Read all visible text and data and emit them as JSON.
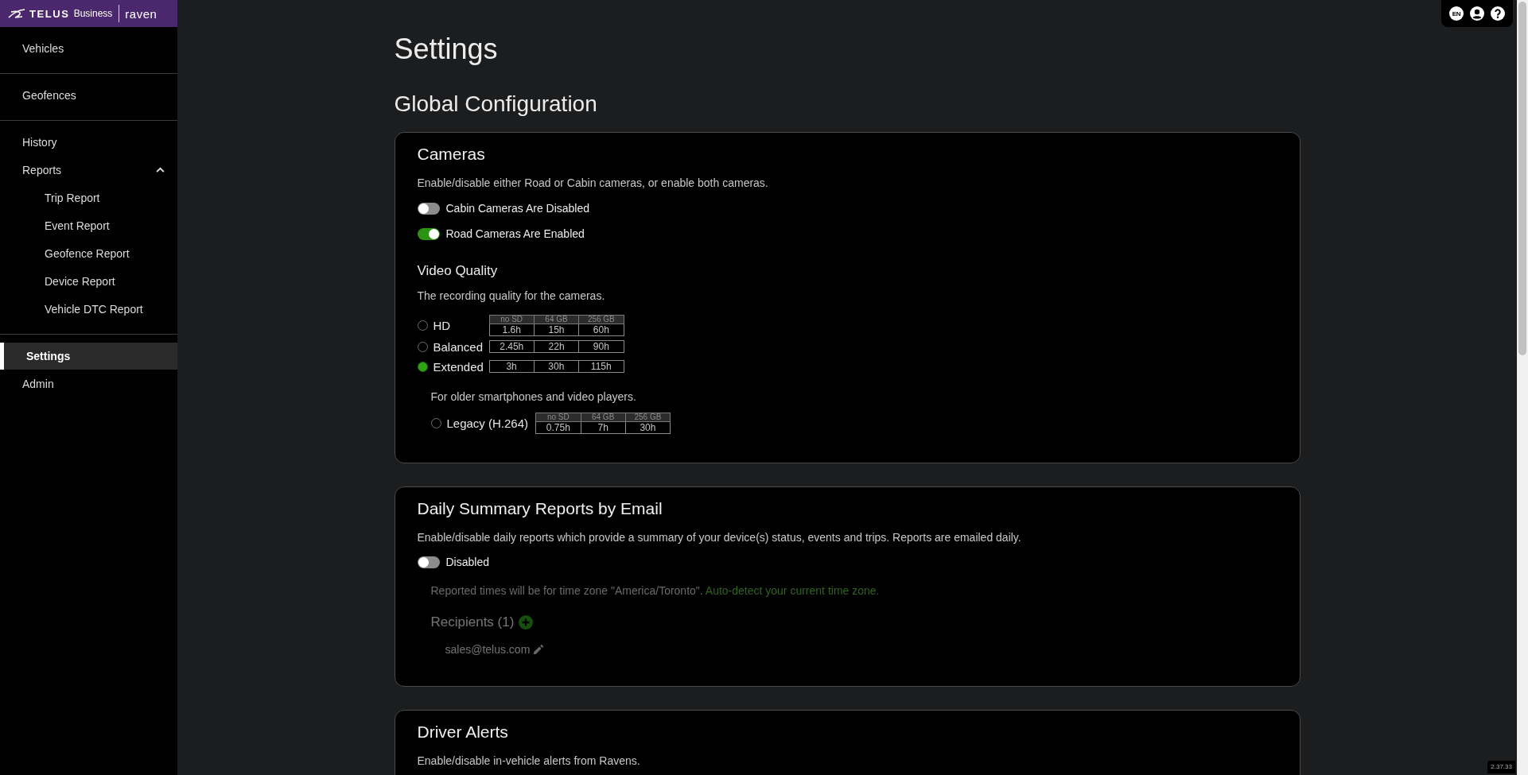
{
  "sidebar": {
    "logo": {
      "brand": "TELUS",
      "tagline": "Business",
      "product": "raven"
    },
    "groups": [
      {
        "items": [
          {
            "label": "Vehicles",
            "selected": false
          }
        ]
      },
      {
        "items": [
          {
            "label": "Geofences",
            "selected": false
          }
        ]
      },
      {
        "items": [
          {
            "label": "History",
            "selected": false
          },
          {
            "label": "Reports",
            "selected": false,
            "expanded": true,
            "children": [
              {
                "label": "Trip Report",
                "selected": false
              },
              {
                "label": "Event Report",
                "selected": false
              },
              {
                "label": "Geofence Report",
                "selected": false
              },
              {
                "label": "Device Report",
                "selected": false
              },
              {
                "label": "Vehicle DTC Report",
                "selected": false
              }
            ]
          }
        ]
      },
      {
        "items": [
          {
            "label": "Settings",
            "selected": true
          },
          {
            "label": "Admin",
            "selected": false
          }
        ]
      }
    ]
  },
  "top_bar": {
    "language": "EN"
  },
  "page_title": "Settings",
  "section_title": "Global Configuration",
  "cameras": {
    "title": "Cameras",
    "description": "Enable/disable either Road or Cabin cameras, or enable both cameras.",
    "toggles": [
      {
        "label": "Cabin Cameras Are Disabled",
        "on": false
      },
      {
        "label": "Road Cameras Are Enabled",
        "on": true
      }
    ],
    "video_quality": {
      "title": "Video Quality",
      "description": "The recording quality for the cameras.",
      "options": [
        {
          "label": "HD",
          "selected": false,
          "table": {
            "headers": [
              "no SD",
              "64 GB",
              "256 GB"
            ],
            "values": [
              "1.6h",
              "15h",
              "60h"
            ]
          }
        },
        {
          "label": "Balanced",
          "selected": false,
          "table": {
            "values": [
              "2.45h",
              "22h",
              "90h"
            ]
          }
        },
        {
          "label": "Extended",
          "selected": true,
          "table": {
            "values": [
              "3h",
              "30h",
              "115h"
            ]
          }
        }
      ],
      "legacy": {
        "note": "For older smartphones and video players.",
        "options": [
          {
            "label": "Legacy (H.264)",
            "selected": false,
            "table": {
              "headers": [
                "no SD",
                "64 GB",
                "256 GB"
              ],
              "values": [
                "0.75h",
                "7h",
                "30h"
              ]
            }
          }
        ]
      }
    }
  },
  "daily_summary": {
    "title": "Daily Summary Reports by Email",
    "description": "Enable/disable daily reports which provide a summary of your device(s) status, events and trips. Reports are emailed daily.",
    "toggle": {
      "label": "Disabled",
      "on": false
    },
    "timezone_note": {
      "text": "Reported times will be for time zone \"America/Toronto\".",
      "link": "Auto-detect your current time zone."
    },
    "recipients": {
      "title": "Recipients (1)",
      "emails": [
        "sales@telus.com"
      ]
    }
  },
  "driver_alerts": {
    "title": "Driver Alerts",
    "description": "Enable/disable in-vehicle alerts from Ravens."
  },
  "version": "2.37.33"
}
